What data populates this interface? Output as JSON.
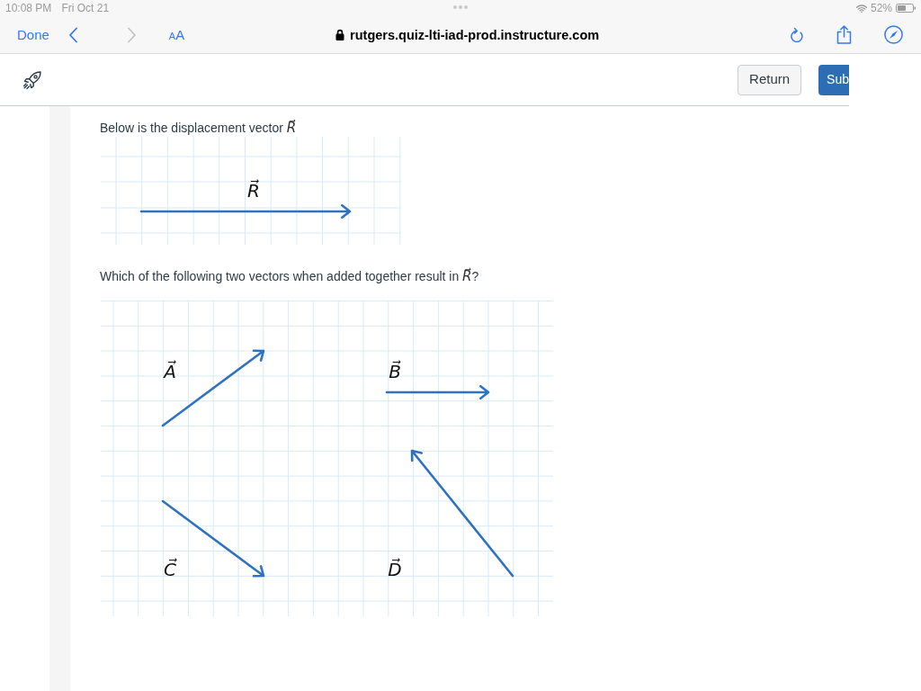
{
  "status_bar": {
    "time": "10:08 PM",
    "date": "Fri Oct 21",
    "battery": "52%"
  },
  "browser_toolbar": {
    "done": "Done",
    "nav_buttons": [
      {
        "kind": "back",
        "disabled": false
      },
      {
        "kind": "forward",
        "disabled": true
      }
    ],
    "text_size": "AA",
    "url": "rutgers.quiz-lti-iad-prod.instructure.com"
  },
  "quiz_header": {
    "buttons": [
      {
        "kind": "secondary",
        "label": "Return"
      },
      {
        "kind": "primary",
        "label": "Sub"
      }
    ]
  },
  "question": {
    "prompt": "Below is the displacement vector *R⃗*",
    "figure_1": {
      "vectors": [
        {
          "label": "R⃗"
        }
      ]
    },
    "question_text": "Which of the following two vectors when added together result in *R⃗*?",
    "figure_2": {
      "vectors": [
        {
          "label": "A⃗"
        },
        {
          "label": "B⃗"
        },
        {
          "label": "C⃗"
        },
        {
          "label": "D⃗"
        }
      ]
    }
  }
}
